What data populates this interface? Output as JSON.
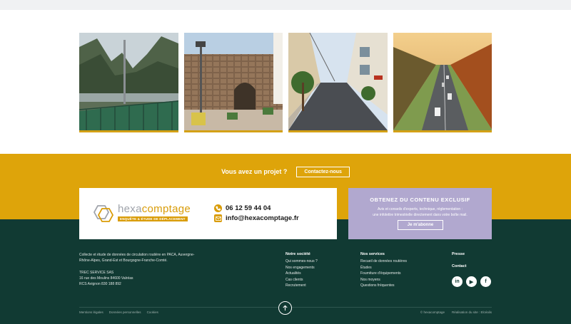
{
  "cta": {
    "question": "Vous avez un projet ?",
    "button_label": "Contactez-nous"
  },
  "logo": {
    "word_a": "hexa",
    "word_b": "comptage",
    "tagline": "ENQUÊTE & ÉTUDE DE DÉPLACEMENT"
  },
  "contact": {
    "phone": "06 12 59 44 04",
    "email": "info@hexacomptage.fr"
  },
  "promo": {
    "title": "OBTENEZ DU CONTENU EXCLUSIF",
    "desc_line1": "Avis et conseils d'experts, technique, réglementation :",
    "desc_line2": "une infolettre trimestrielle directement dans votre boîte mail.",
    "button_label": "Je m'abonne"
  },
  "footer": {
    "about_line1": "Collecte et étude de données de circulation routière en PACA, Auvergne-",
    "about_line2": "Rhône-Alpes, Grand-Est et Bourgogne-Franche-Comté.",
    "company": "TREC SERVICE SAS",
    "address": "16 rue des Moulins 84600 Valréas",
    "rcs": "RCS Avignon 830 188 892",
    "society": {
      "title": "Notre société",
      "links": [
        "Qui sommes-nous ?",
        "Nos engagements",
        "Actualités",
        "Cas clients",
        "Recrutement"
      ]
    },
    "services": {
      "title": "Nos services",
      "links": [
        "Recueil de données routières",
        "Études",
        "Fourniture d'équipements",
        "Nos moyens",
        "Questions fréquentes"
      ]
    },
    "press": "Presse",
    "contact": "Contact",
    "socials": [
      {
        "icon": "linkedin-icon",
        "glyph": "in"
      },
      {
        "icon": "youtube-icon",
        "glyph": "▶"
      },
      {
        "icon": "facebook-icon",
        "glyph": "f"
      }
    ],
    "legal": [
      "Mentions légales",
      "Données personnelles",
      "Cookies"
    ],
    "copyright": "© hexacomptage",
    "credits": "Réalisation du site : Elcéalis"
  },
  "colors": {
    "accent": "#dea40a",
    "footer_bg": "#113a33",
    "promo_bg": "#b1a8cf"
  }
}
